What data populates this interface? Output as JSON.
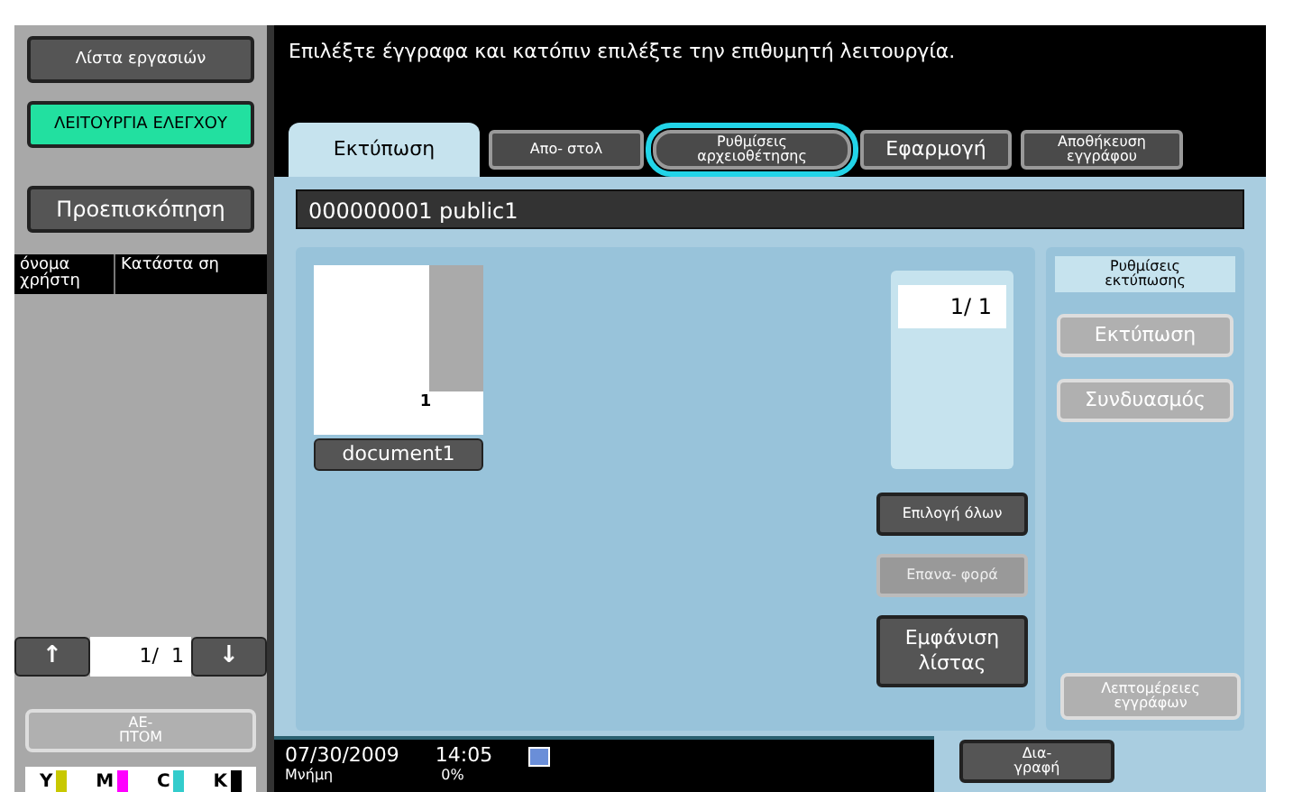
{
  "sidebar": {
    "buttons": [
      {
        "label": "Λίστα εργασιών",
        "selected": false
      },
      {
        "label": "ΛΕΙΤΟΥΡΓΙΑ ΕΛΕΓΧΟΥ",
        "selected": true
      },
      {
        "label": "Προεπισκόπηση",
        "selected": false
      }
    ],
    "list_header": [
      "όνομα χρήστη",
      "Κατάστα ση"
    ],
    "pager": {
      "up": "↑",
      "page": "1/  1",
      "down": "↓"
    },
    "detail_button": "ΑΕ- ΠΤΟΜ",
    "toners": [
      {
        "label": "Y",
        "color": "#c8c800",
        "level": 1
      },
      {
        "label": "M",
        "color": "#ff00ff",
        "level": 1
      },
      {
        "label": "C",
        "color": "#33cccc",
        "level": 1
      },
      {
        "label": "K",
        "color": "#000000",
        "level": 1
      }
    ]
  },
  "message": "Επιλέξτε έγγραφα και κατόπιν επιλέξτε την επιθυμητή λειτουργία.",
  "tabs": [
    {
      "label": "Εκτύπωση",
      "selected": true,
      "highlighted": false
    },
    {
      "label": "Απο- στολ",
      "selected": false,
      "highlighted": false
    },
    {
      "label": "Ρυθμίσεις αρχειοθέτησης",
      "selected": false,
      "highlighted": true
    },
    {
      "label": "Εφαρμογή",
      "selected": false,
      "highlighted": false
    },
    {
      "label": "Αποθήκευση εγγράφου",
      "selected": false,
      "highlighted": false
    }
  ],
  "box_title": "000000001   public1",
  "document": {
    "pages": "1",
    "name": "document1"
  },
  "page_counter": "1/   1",
  "actions": [
    {
      "label": "Επιλογή όλων",
      "disabled": false
    },
    {
      "label": "Επανα- φορά",
      "disabled": true
    },
    {
      "label": "Εμφάνιση λίστας",
      "disabled": false
    }
  ],
  "print_settings": {
    "title": "Ρυθμίσεις εκτύπωσης",
    "buttons": [
      "Εκτύπωση",
      "Συνδυασμός"
    ]
  },
  "details_button": "Λεπτομέρειες εγγράφων",
  "status": {
    "date": "07/30/2009",
    "time": "14:05",
    "memory_label": "Μνήμη",
    "memory": "0%"
  },
  "delete_button": "Δια- γραφή"
}
